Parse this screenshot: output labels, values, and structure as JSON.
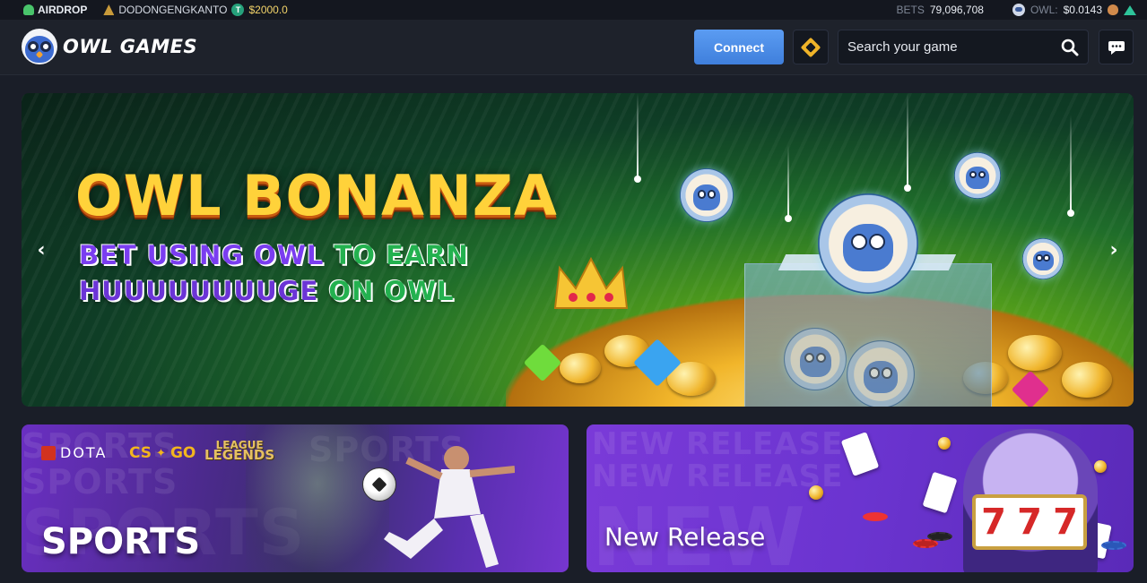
{
  "ticker": {
    "airdrop_label": "AIRDROP",
    "username": "DODONGENGKANTO",
    "token_symbol": "T",
    "balance": "$2000.0",
    "bets_label": "BETS",
    "bets_value": "79,096,708",
    "owl_label": "OWL:",
    "owl_price": "$0.0143"
  },
  "header": {
    "logo_text": "OWL GAMES",
    "connect_label": "Connect",
    "search_placeholder": "Search your game",
    "icons": [
      "cube-icon",
      "search-icon",
      "chat-icon"
    ]
  },
  "hero": {
    "title": "OWL BONANZA",
    "line1_a": "BET USING OWL",
    "line1_b": "TO EARN",
    "line2_a": "HUUUUUUUUGE",
    "line2_b": "ON OWL",
    "prev_glyph": "‹",
    "next_glyph": "›"
  },
  "cards": [
    {
      "label": "SPORTS",
      "brands": [
        "DOTA",
        "CS",
        "GO",
        "LEAGUE",
        "LEGENDS"
      ],
      "ghost_text": "SPORTS"
    },
    {
      "label": "New Release",
      "ghost_text": "NEW RELEASE",
      "ghost_big": "NEW",
      "reels": [
        "7",
        "7",
        "7"
      ]
    }
  ],
  "colors": {
    "accent": "#4a8ae6",
    "gold": "#ffd23a",
    "purple": "#6b34d0",
    "bg": "#1a1e28"
  }
}
